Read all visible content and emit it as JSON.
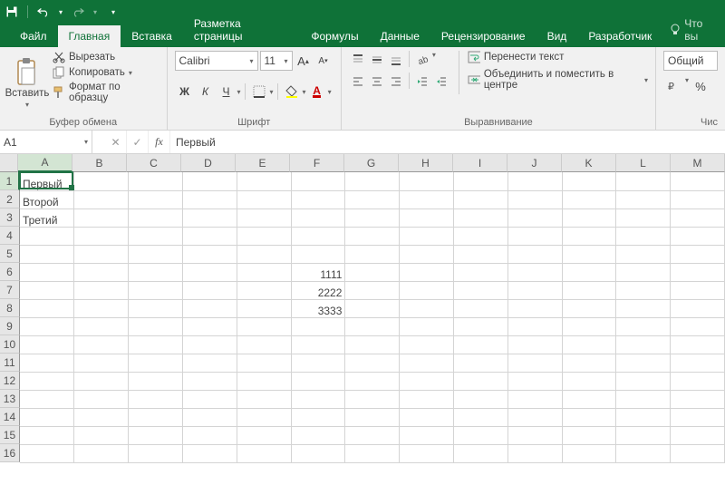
{
  "qat": {
    "undo_tip": "Отменить",
    "redo_tip": "Вернуть",
    "save_tip": "Сохранить"
  },
  "tabs": {
    "file": "Файл",
    "home": "Главная",
    "insert": "Вставка",
    "layout": "Разметка страницы",
    "formulas": "Формулы",
    "data": "Данные",
    "review": "Рецензирование",
    "view": "Вид",
    "developer": "Разработчик",
    "tell_me": "Что вы"
  },
  "clipboard": {
    "paste": "Вставить",
    "cut": "Вырезать",
    "copy": "Копировать",
    "format_painter": "Формат по образцу",
    "group": "Буфер обмена"
  },
  "font": {
    "name": "Calibri",
    "size": "11",
    "bold": "Ж",
    "italic": "К",
    "underline": "Ч",
    "group": "Шрифт"
  },
  "alignment": {
    "wrap": "Перенести текст",
    "merge": "Объединить и поместить в центре",
    "group": "Выравнивание"
  },
  "number": {
    "format": "Общий",
    "group": "Чис"
  },
  "formula_bar": {
    "name_box": "A1",
    "value": "Первый"
  },
  "columns": [
    "A",
    "B",
    "C",
    "D",
    "E",
    "F",
    "G",
    "H",
    "I",
    "J",
    "K",
    "L",
    "M"
  ],
  "rows": [
    "1",
    "2",
    "3",
    "4",
    "5",
    "6",
    "7",
    "8",
    "9",
    "10",
    "11",
    "12",
    "13",
    "14",
    "15",
    "16"
  ],
  "cells": {
    "A1": "Первый",
    "A2": "Второй",
    "A3": "Третий",
    "F6": "1111",
    "F7": "2222",
    "F8": "3333"
  },
  "selection": {
    "ref": "A1",
    "col": 0,
    "row": 0
  }
}
